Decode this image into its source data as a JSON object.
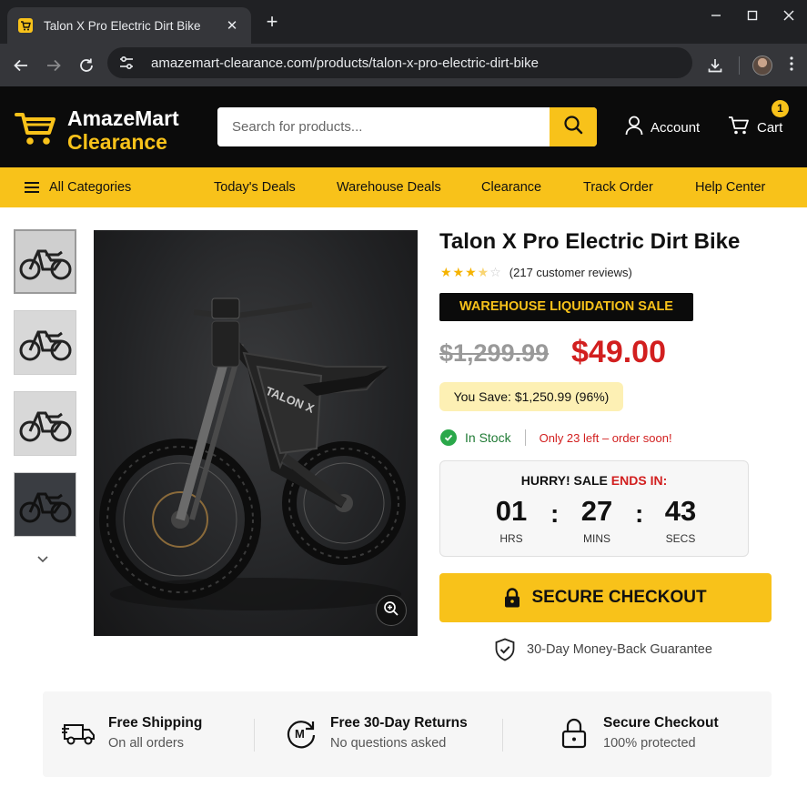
{
  "browser": {
    "tab_title": "Talon X Pro Electric Dirt Bike",
    "tab_close": "✕",
    "new_tab": "+",
    "url": "amazemart-clearance.com/products/talon-x-pro-electric-dirt-bike"
  },
  "site": {
    "logo_line1": "AmazeMart",
    "logo_line2": "Clearance",
    "search_placeholder": "Search for products...",
    "account_label": "Account",
    "cart_label": "Cart",
    "cart_count": "1",
    "brand_color": "#f8c21a"
  },
  "nav": {
    "all_categories": "All Categories",
    "items": [
      "Today's Deals",
      "Warehouse Deals",
      "Clearance",
      "Track Order",
      "Help Center"
    ]
  },
  "product": {
    "title": "Talon X Pro Electric Dirt Bike",
    "rating_stars": 3.5,
    "reviews": "(217 customer reviews)",
    "sale_banner": "WAREHOUSE LIQUIDATION SALE",
    "old_price": "$1,299.99",
    "new_price": "$49.00",
    "you_save": "You Save: $1,250.99 (96%)",
    "in_stock": "In Stock",
    "stock_note": "Only 23 left – order soon!",
    "price_color": "#d21f1f"
  },
  "timer": {
    "heading_prefix": "HURRY! SALE",
    "heading_suffix": "ENDS IN:",
    "hours": "01",
    "hours_label": "HRS",
    "minutes": "27",
    "minutes_label": "MINS",
    "seconds": "43",
    "seconds_label": "SECS",
    "separator": ":"
  },
  "checkout": {
    "button": "SECURE CHECKOUT",
    "guarantee": "30-Day Money-Back Guarantee"
  },
  "features": [
    {
      "title": "Free Shipping",
      "subtitle": "On all orders",
      "icon": "truck-icon"
    },
    {
      "title": "Free 30-Day Returns",
      "subtitle": "No questions asked",
      "icon": "returns-icon"
    },
    {
      "title": "Secure Checkout",
      "subtitle": "100% protected",
      "icon": "padlock-icon"
    }
  ]
}
